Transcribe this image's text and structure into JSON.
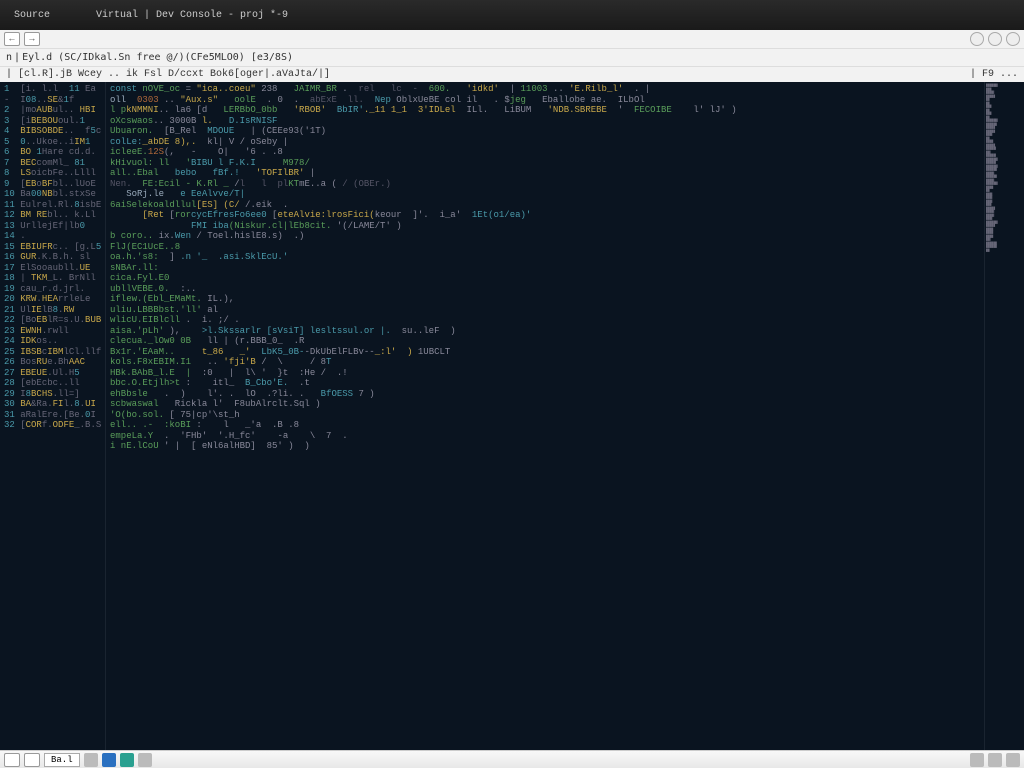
{
  "titlebar": {
    "tabs": [
      "Source",
      "Virtual | Dev Console - proj *-9"
    ]
  },
  "toolbar": {
    "back": "←",
    "fwd": "→"
  },
  "pathbar": {
    "segments": [
      "n",
      "Eyl.d (SC/IDkal.Sn free @/)(CFe5MLO0) [e3/8S)"
    ]
  },
  "menubar": {
    "left": "| [cl.R].jB  Wcey .. ik Fsl D/ccxt Bok6[oger|.aVaJta/|]",
    "right": "| F9 ..."
  },
  "gutter_lines": [
    "1  [i. l.l  11 Ea",
    "-  I08..SE&1f",
    "2  |moAUBul.. HBI",
    "3  [iBEBOUoul.1",
    "4  BIBSOBDE..  f5c",
    "5  0..Ukoe..iIM1",
    "6  BO 1Hare cd.d.",
    "7  BECcomMl_ 81",
    "8  LSoicbFe..Llll",
    "9  [EBoBFbl..lUoE",
    "10 Ba00NBbl.stxSe",
    "11 Eulrel.Rl.8isbE",
    "12 BM REbl.. k.Ll",
    "13 UrllejEf|lb0",
    "14 .",
    "15 EBIUFRc.. [g.L5",
    "16 GUR.K.B.h. sl",
    "17 ElSooaubll.UE",
    "18 | TKM_L. BrNll",
    "19 cau_r.d.jrl.",
    "20 KRW.HEArrleLe",
    "21 UlIElB8.RW",
    "22 [BoEBlR=s.U.BUB",
    "23 EWNH.rwll",
    "24 IDKos..",
    "25 IBSBcIBMlCl.llf",
    "26 BosRUe.BhAAC",
    "27 EBEUE.Ul.H5",
    "28 [ebEcbc..ll",
    "29 I8BCHS.ll=]",
    "30 BA&Ra.FIl.8.UI",
    "31 aRalEre.[Be.0I",
    "32 [CORf.ODFE_.B.S"
  ],
  "code_lines": [
    {
      "segs": [
        [
          "k",
          "const "
        ],
        [
          "n",
          "nOVE_oc"
        ],
        [
          "p",
          " = "
        ],
        [
          "s",
          "\"ica..coeu\""
        ],
        [
          "p",
          " 238   "
        ],
        [
          "n",
          "JAIMR_BR"
        ],
        [
          "p",
          " . "
        ],
        [
          "c",
          " rel   lc  -  "
        ],
        [
          "n",
          "600."
        ],
        [
          "p",
          "   "
        ],
        [
          "s",
          "'idkd'"
        ],
        [
          "p",
          "  | "
        ],
        [
          "n",
          "11003"
        ],
        [
          "p",
          " .. "
        ],
        [
          "s",
          "'E.Rilb_l'"
        ],
        [
          "p",
          "  . |"
        ]
      ]
    },
    {
      "segs": [
        [
          "t",
          "oll  "
        ],
        [
          "m",
          "0303"
        ],
        [
          "p",
          " .. "
        ],
        [
          "s",
          "\"Aux.s\""
        ],
        [
          "p",
          "   "
        ],
        [
          "n",
          "oolE"
        ],
        [
          "p",
          "  . 0  .  "
        ],
        [
          "c",
          "abExE  ll.  "
        ],
        [
          "k",
          "Nep "
        ],
        [
          "p",
          "OblxUeBE col il   . $"
        ],
        [
          "n",
          "jeg "
        ],
        [
          "p",
          "  Eballobe ae.  ILbOl"
        ]
      ]
    },
    {
      "segs": [
        [
          "n",
          "l p"
        ],
        [
          "s",
          "kNMMNI"
        ],
        [
          "p",
          ".. la6 [d   "
        ],
        [
          "n",
          "LERBbO_0bb"
        ],
        [
          "p",
          "   "
        ],
        [
          "s",
          "'RBOB'"
        ],
        [
          "p",
          "  "
        ],
        [
          "k",
          "BbIR'"
        ],
        [
          "s",
          "._11 1_1  3'IDLel"
        ],
        [
          "p",
          "  ILl.   LiBUM   "
        ],
        [
          "s",
          "'NDB.SBREBE"
        ],
        [
          "p",
          "  '  "
        ],
        [
          "n",
          "FECOIBE"
        ],
        [
          "p",
          "    l' lJ' )"
        ]
      ]
    },
    {
      "segs": [
        [
          "n",
          "oXcswaos"
        ],
        [
          "p",
          ".. 3000B"
        ],
        [
          "s",
          " l.   "
        ],
        [
          "k",
          "D.IsRNISF"
        ]
      ]
    },
    {
      "segs": [
        [
          "n",
          "Ubuaron."
        ],
        [
          "p",
          "  [B_Rel  "
        ],
        [
          "k",
          "MDOUE"
        ],
        [
          "p",
          "   | (CEEe93('1T)"
        ]
      ]
    },
    {
      "segs": [
        [
          "k",
          "colLe:"
        ],
        [
          "s",
          "_abDE 8),.  "
        ],
        [
          "p",
          "kl| V / oSeby |"
        ]
      ]
    },
    {
      "segs": [
        [
          "n",
          "icleeE."
        ],
        [
          "m",
          "12S"
        ],
        [
          "p",
          "(,   -    O|   '6 . .8"
        ]
      ]
    },
    {
      "segs": [
        [
          "n",
          "kHivuol: ll   '"
        ],
        [
          "k",
          "BIBU l F.K.I"
        ],
        [
          "p",
          "     "
        ],
        [
          "n",
          "M978/"
        ]
      ]
    },
    {
      "segs": [
        [
          "n",
          "all..Ebal"
        ],
        [
          "p",
          "   "
        ],
        [
          "k",
          "bebo   fBf.!"
        ],
        [
          "p",
          "   "
        ],
        [
          "s",
          "'TOFIlBR'"
        ],
        [
          "p",
          " |"
        ]
      ]
    },
    {
      "segs": [
        [
          "c",
          "Nen.  "
        ],
        [
          "n",
          "FE:Ecil - K.Rl _"
        ],
        [
          "p",
          " /"
        ],
        [
          "c",
          "l   l  pl"
        ],
        [
          "n",
          "KT"
        ],
        [
          "p",
          "mE..a ("
        ],
        [
          "c",
          " / (OBEr.)"
        ]
      ]
    },
    {
      "segs": [
        [
          "t",
          "   SoRj.le   "
        ],
        [
          "k",
          "e EeAlvve/T|"
        ]
      ]
    },
    {
      "segs": [
        [
          "n",
          "6aiSelekoaldllul"
        ],
        [
          "s",
          "[ES] (C/"
        ],
        [
          "p",
          " /.eik  ."
        ]
      ]
    },
    {
      "segs": [
        [
          "t",
          "      "
        ],
        [
          "s",
          "[Ret "
        ],
        [
          "p",
          "["
        ],
        [
          "n",
          "ror"
        ],
        [
          "k",
          "cycEfresFo6ee0"
        ],
        [
          "p",
          " ["
        ],
        [
          "s",
          "eteAlvie:lrosFici("
        ],
        [
          "p",
          "keour  ]'.  i_a'  "
        ],
        [
          "k",
          "1Et(o1/ea)'"
        ]
      ]
    },
    {
      "segs": [
        [
          "t",
          "               "
        ],
        [
          "k",
          "FMI iba"
        ],
        [
          "n",
          "(Niskur.cl|lEb8cit."
        ],
        [
          "p",
          " '(/LAME/T' )"
        ]
      ]
    },
    {
      "segs": [
        [
          "n",
          "b coro.. "
        ],
        [
          "p",
          "ix."
        ],
        [
          "k",
          "Wen"
        ],
        [
          "p",
          " / Toel.hislE8.s)  .)"
        ]
      ]
    },
    {
      "segs": [
        [
          "t",
          ""
        ]
      ]
    },
    {
      "segs": [
        [
          "n",
          "FlJ(EC1UcE..8"
        ]
      ]
    },
    {
      "segs": [
        [
          "n",
          "oa.h.'s8:"
        ],
        [
          "p",
          "  ]"
        ],
        [
          "k",
          " .n '_  .asi.SklEcU.'"
        ]
      ]
    },
    {
      "segs": [
        [
          "n",
          "sNBAr.ll:"
        ]
      ]
    },
    {
      "segs": [
        [
          "n",
          "cica.Fyl.E0"
        ]
      ]
    },
    {
      "segs": [
        [
          "n",
          "ubllVEBE.0."
        ],
        [
          "p",
          "  :.."
        ]
      ]
    },
    {
      "segs": [
        [
          "n",
          "iflew.(Ebl_EMaMt."
        ],
        [
          "p",
          " IL.),"
        ]
      ]
    },
    {
      "segs": [
        [
          "n",
          "uliu.LBBBbst.'ll'"
        ],
        [
          "p",
          " al"
        ]
      ]
    },
    {
      "segs": [
        [
          "n",
          "wlicU.EIBlcll"
        ],
        [
          "p",
          " .  i. ;/ ."
        ]
      ]
    },
    {
      "segs": [
        [
          "n",
          "aisa.'pLh'"
        ],
        [
          "p",
          " ),    "
        ],
        [
          "k",
          ">l.Skssarlr [sVsiT] lesltssul.or |."
        ],
        [
          "p",
          "  su..leF  )"
        ]
      ]
    },
    {
      "segs": [
        [
          "n",
          "clecua._lOw0 0B"
        ],
        [
          "p",
          "   ll | (r.BBB_0_  .R"
        ]
      ]
    },
    {
      "segs": [
        [
          "n",
          "Bx1r.'EAaM.."
        ],
        [
          "p",
          "     "
        ],
        [
          "s",
          "t_86   _'  "
        ],
        [
          "k",
          "LbK5_0B-"
        ],
        [
          "p",
          "-DkUbElFLBv--"
        ],
        [
          "s",
          "_:l'  )"
        ],
        [
          "p",
          " 1UBCLT"
        ]
      ]
    },
    {
      "segs": [
        [
          "n",
          "kols.F8xEBIM.I1"
        ],
        [
          "p",
          "   .. "
        ],
        [
          "s",
          "'fji'B"
        ],
        [
          "p",
          " /  \\     / 8"
        ],
        [
          "k",
          "T"
        ]
      ]
    },
    {
      "segs": [
        [
          "n",
          "HBk.BAbB_l.E  |"
        ],
        [
          "p",
          "  :0   |  l\\ '  }t  :He /  .!"
        ]
      ]
    },
    {
      "segs": [
        [
          "n",
          "bbc.O.Etjlh>t"
        ],
        [
          "p",
          " :    itl_  "
        ],
        [
          "k",
          "B_Cbo'E."
        ],
        [
          "p",
          "  .t"
        ]
      ]
    },
    {
      "segs": [
        [
          "n",
          "ehBbsle"
        ],
        [
          "p",
          "   .  )    l'. .  lO  .?li. .   "
        ],
        [
          "k",
          "BfOESS"
        ],
        [
          "p",
          " 7 )"
        ]
      ]
    },
    {
      "segs": [
        [
          "n",
          "scbwaswal"
        ],
        [
          "p",
          "   Rickla l'  F8ubAlrclt.Sql )"
        ]
      ]
    },
    {
      "segs": [
        [
          "n",
          "'O(bo.sol."
        ],
        [
          "p",
          " [ 75|cp'\\st_h"
        ]
      ]
    },
    {
      "segs": [
        [
          "n",
          "ell.. .-  :koBI"
        ],
        [
          "p",
          " :    l   _'a  .B .8"
        ]
      ]
    },
    {
      "segs": [
        [
          "n",
          "empeLa.Y"
        ],
        [
          "p",
          "  .  'FHb'  '.H_fc'    -a    \\  7  ."
        ]
      ]
    },
    {
      "segs": [
        [
          "n",
          "i nE.lCoU"
        ],
        [
          "p",
          " ' |  [ eNl6alHBD]  85' )  )"
        ]
      ]
    }
  ],
  "minimap_lines": 48,
  "taskbar": {
    "tasks": [
      "Ba.l"
    ]
  }
}
